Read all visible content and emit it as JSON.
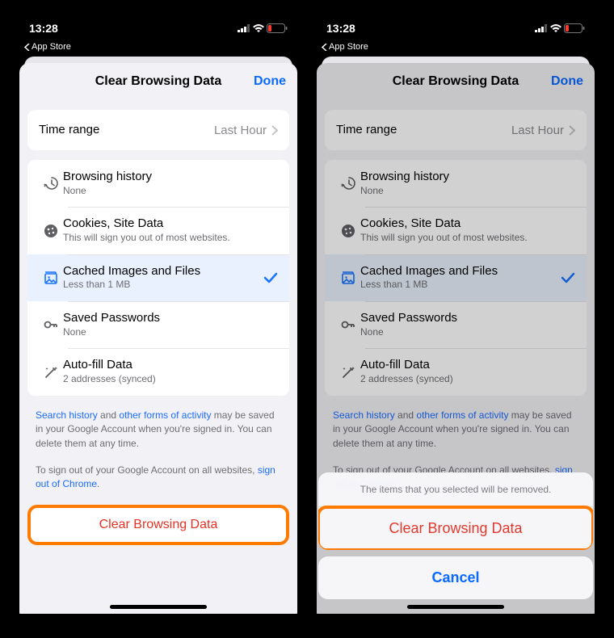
{
  "status": {
    "time": "13:28",
    "breadcrumb": "App Store"
  },
  "header": {
    "title": "Clear Browsing Data",
    "done": "Done"
  },
  "timerange": {
    "label": "Time range",
    "value": "Last Hour"
  },
  "items": [
    {
      "title": "Browsing history",
      "sub": "None",
      "icon": "history-icon",
      "selected": false
    },
    {
      "title": "Cookies, Site Data",
      "sub": "This will sign you out of most websites.",
      "icon": "cookie-icon",
      "selected": false
    },
    {
      "title": "Cached Images and Files",
      "sub": "Less than 1 MB",
      "icon": "image-icon",
      "selected": true
    },
    {
      "title": "Saved Passwords",
      "sub": "None",
      "icon": "key-icon",
      "selected": false
    },
    {
      "title": "Auto-fill Data",
      "sub": "2 addresses (synced)",
      "icon": "wand-icon",
      "selected": false
    }
  ],
  "fineprint": {
    "link1": "Search history",
    "mid1": " and ",
    "link2": "other forms of activity",
    "tail1": " may be saved in your Google Account when you're signed in. You can delete them at any time.",
    "lead2": "To sign out of your Google Account on all websites, ",
    "link3": "sign out of Chrome",
    "period": "."
  },
  "clear_button": "Clear Browsing Data",
  "actionsheet": {
    "message": "The items that you selected will be removed.",
    "destructive": "Clear Browsing Data",
    "cancel": "Cancel"
  }
}
